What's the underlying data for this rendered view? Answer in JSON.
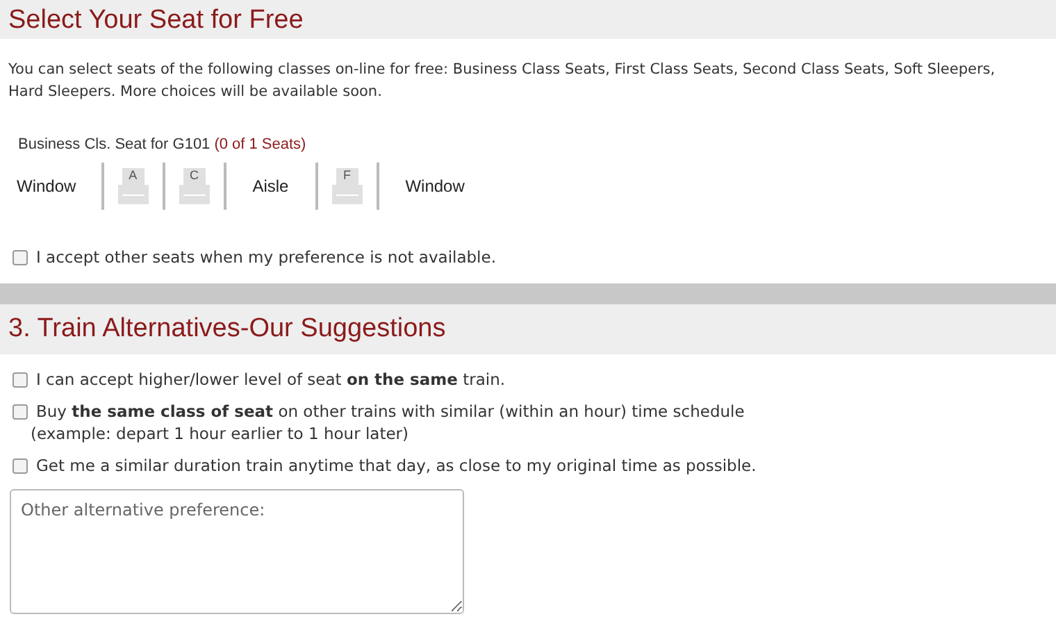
{
  "seat_section": {
    "title": "Select Your Seat for Free",
    "intro": "You can select seats of the following classes on-line for free: Business Class Seats, First Class Seats, Second Class Seats, Soft Sleepers, Hard Sleepers. More choices will be available soon.",
    "seat_label": "Business Cls. Seat for G101",
    "seat_count": "(0 of 1 Seats)",
    "seat_row": [
      {
        "kind": "label",
        "text": "Window"
      },
      {
        "kind": "seat",
        "text": "A",
        "selected": false
      },
      {
        "kind": "seat",
        "text": "C",
        "selected": false
      },
      {
        "kind": "label",
        "text": "Aisle"
      },
      {
        "kind": "seat",
        "text": "F",
        "selected": false
      },
      {
        "kind": "label",
        "text": "Window"
      }
    ],
    "accept_other": {
      "label": "I accept other seats when my preference is not available.",
      "checked": false
    }
  },
  "alternatives_section": {
    "title": "3. Train Alternatives-Our Suggestions",
    "options": [
      {
        "label": "I can accept higher/lower level of seat **on the same** train.",
        "checked": false
      },
      {
        "label": "Buy **the same class of seat** on other trains with similar (within an hour) time schedule",
        "note": "(example: depart 1 hour earlier to 1 hour later)",
        "checked": false
      },
      {
        "label": "Get me a similar duration train anytime that day, as close to my original time as possible.",
        "checked": false
      }
    ],
    "other_field": {
      "placeholder": "Other alternative preference:"
    }
  }
}
